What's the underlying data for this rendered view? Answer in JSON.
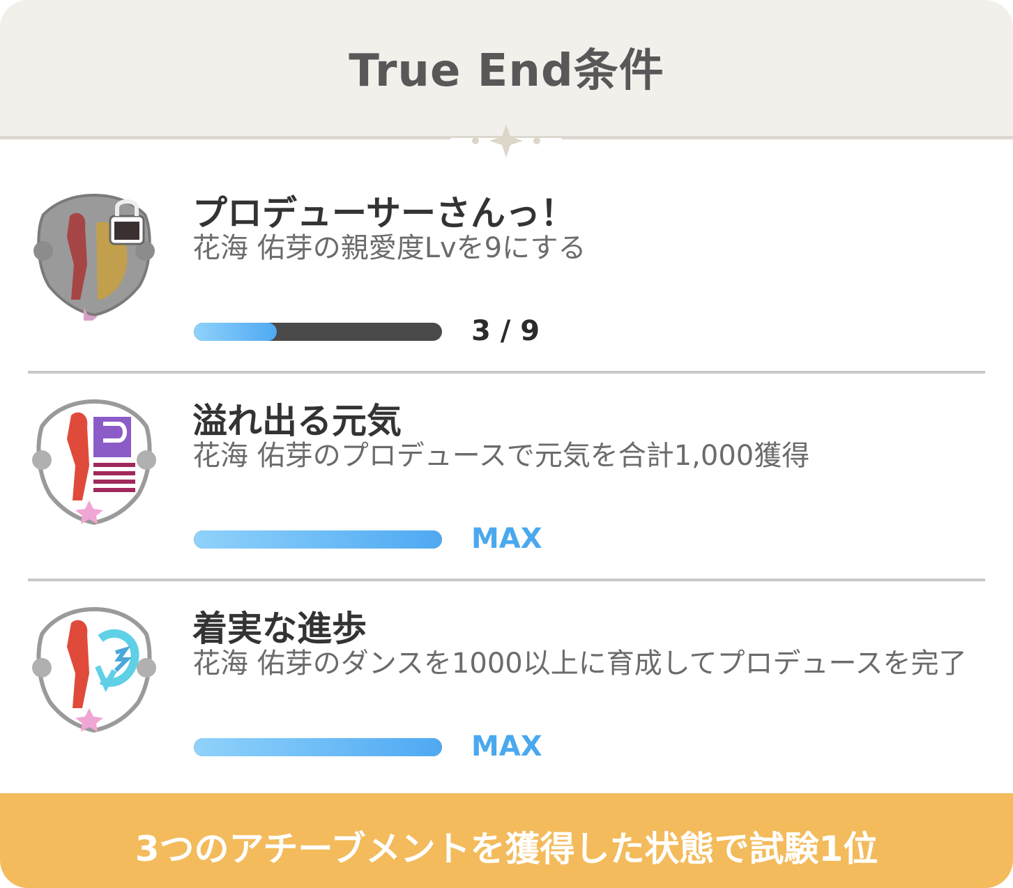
{
  "dialog": {
    "title": "True End条件"
  },
  "achievements": [
    {
      "title": "プロデューサーさんっ！",
      "description": "花海 佑芽の親愛度Lvを9にする",
      "progress_text": "3 / 9",
      "progress": 0.333,
      "locked": true,
      "badge_icon": "silhouette-heart-badge-icon"
    },
    {
      "title": "溢れ出る元気",
      "description": "花海 佑芽のプロデュースで元気を合計1,000獲得",
      "progress_text": "MAX",
      "progress": 1.0,
      "locked": false,
      "badge_icon": "energy-p-badge-icon"
    },
    {
      "title": "着実な進歩",
      "description": "花海 佑芽のダンスを1000以上に育成してプロデュースを完了",
      "progress_text": "MAX",
      "progress": 1.0,
      "locked": false,
      "badge_icon": "dance-arrow-badge-icon"
    }
  ],
  "footer": {
    "text": "3つのアチーブメントを獲得した状態で試験1位"
  },
  "colors": {
    "header_bg": "#f2f0ea",
    "footer_bg": "#f3bb5c",
    "progress_fill": "#4fa9f2",
    "progress_track": "#4a4a4a",
    "max_text": "#4aa8ee"
  }
}
